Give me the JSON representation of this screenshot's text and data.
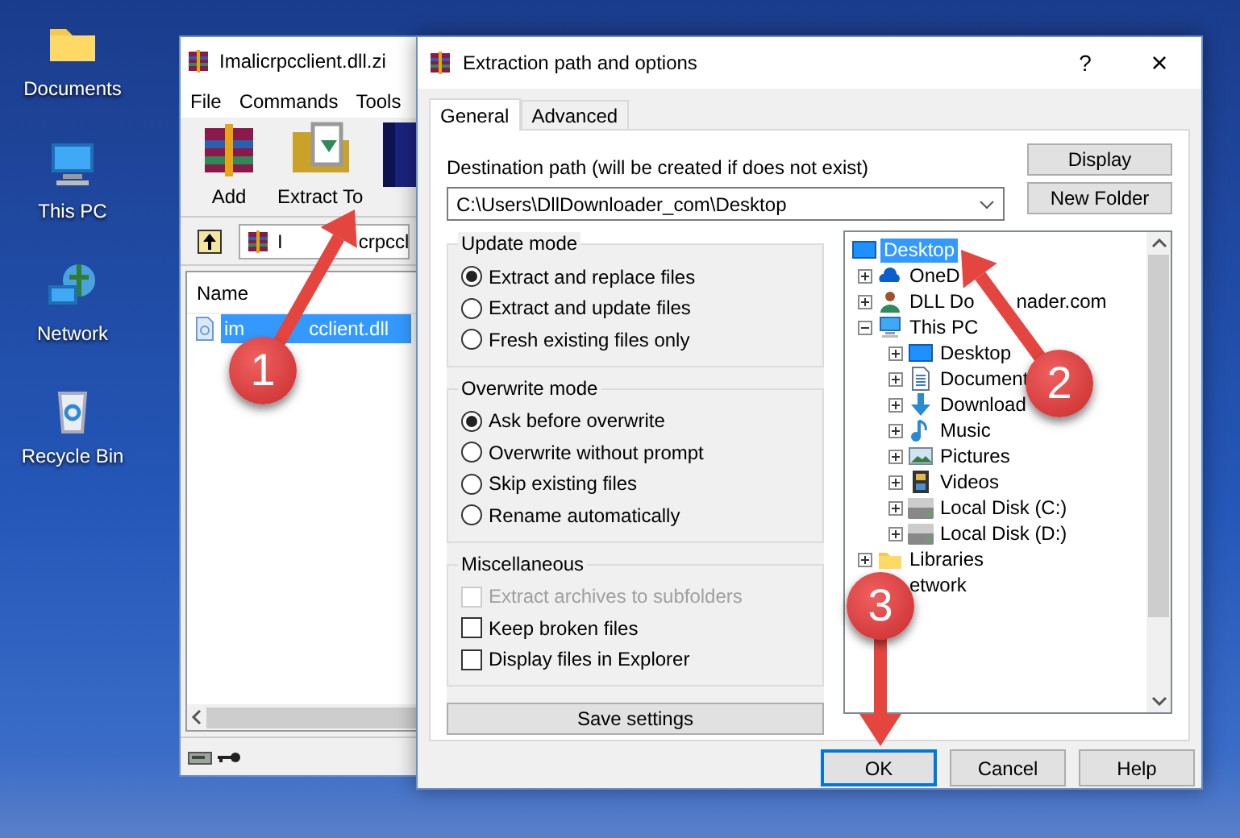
{
  "desktop_icons": [
    {
      "label": "Documents",
      "kind": "folder"
    },
    {
      "label": "This PC",
      "kind": "pc"
    },
    {
      "label": "Network",
      "kind": "network"
    },
    {
      "label": "Recycle Bin",
      "kind": "bin"
    }
  ],
  "archive_window": {
    "title": "Imalicrpcclient.dll.zi",
    "menu": [
      "File",
      "Commands",
      "Tools"
    ],
    "toolbar": [
      {
        "label": "Add",
        "kind": "add"
      },
      {
        "label": "Extract To",
        "kind": "extract"
      },
      {
        "kind": "book"
      }
    ],
    "path_parts": [
      "I",
      "crpccl"
    ],
    "columns": [
      "Name"
    ],
    "files": [
      {
        "name_parts": [
          "im",
          "cclient.dll"
        ],
        "selected": true
      }
    ]
  },
  "dialog": {
    "title": "Extraction path and options",
    "help": "?",
    "close": "×",
    "tabs": [
      {
        "label": "General",
        "selected": true
      },
      {
        "label": "Advanced",
        "selected": false
      }
    ],
    "destination_label": "Destination path (will be created if does not exist)",
    "destination_path": "C:\\Users\\DllDownloader_com\\Desktop",
    "side_buttons": [
      "Display",
      "New Folder"
    ],
    "update_mode": {
      "title": "Update mode",
      "options": [
        {
          "label": "Extract and replace files",
          "selected": true
        },
        {
          "label": "Extract and update files",
          "selected": false
        },
        {
          "label": "Fresh existing files only",
          "selected": false
        }
      ]
    },
    "overwrite_mode": {
      "title": "Overwrite mode",
      "options": [
        {
          "label": "Ask before overwrite",
          "selected": true
        },
        {
          "label": "Overwrite without prompt",
          "selected": false
        },
        {
          "label": "Skip existing files",
          "selected": false
        },
        {
          "label": "Rename automatically",
          "selected": false
        }
      ]
    },
    "miscellaneous": {
      "title": "Miscellaneous",
      "options": [
        {
          "label": "Extract archives to subfolders",
          "checked": false,
          "disabled": true
        },
        {
          "label": "Keep broken files",
          "checked": false,
          "disabled": false
        },
        {
          "label": "Display files in Explorer",
          "checked": false,
          "disabled": false
        }
      ]
    },
    "save_button": "Save settings",
    "tree": [
      {
        "label": "Desktop",
        "kind": "monitor",
        "selected": true,
        "children": [
          {
            "label": "OneD",
            "kind": "cloud",
            "selected": false,
            "expanded": false
          },
          {
            "label_parts": [
              "DLL Do",
              "nader.com"
            ],
            "kind": "user",
            "selected": false,
            "expanded": false
          },
          {
            "label": "This PC",
            "kind": "pc",
            "selected": false,
            "expanded": true,
            "children": [
              {
                "label": "Desktop",
                "kind": "monitor",
                "selected": false,
                "expanded": false
              },
              {
                "label": "Document",
                "kind": "document",
                "selected": false,
                "expanded": false
              },
              {
                "label": "Download",
                "kind": "download",
                "selected": false,
                "expanded": false
              },
              {
                "label": "Music",
                "kind": "music",
                "selected": false,
                "expanded": false
              },
              {
                "label": "Pictures",
                "kind": "picture",
                "selected": false,
                "expanded": false
              },
              {
                "label": "Videos",
                "kind": "video",
                "selected": false,
                "expanded": false
              },
              {
                "label": "Local Disk (C:)",
                "kind": "disk",
                "selected": false,
                "expanded": false
              },
              {
                "label": "Local Disk (D:)",
                "kind": "disk",
                "selected": false,
                "expanded": false
              }
            ]
          },
          {
            "label": "Libraries",
            "kind": "folder",
            "selected": false,
            "expanded": false
          },
          {
            "label": "etwork",
            "selected": false
          }
        ]
      }
    ],
    "footer_buttons": [
      {
        "label": "OK",
        "focused": true
      },
      {
        "label": "Cancel",
        "focused": false
      },
      {
        "label": "Help",
        "focused": false
      }
    ]
  },
  "annotations": [
    {
      "number": "1"
    },
    {
      "number": "2"
    },
    {
      "number": "3"
    }
  ]
}
